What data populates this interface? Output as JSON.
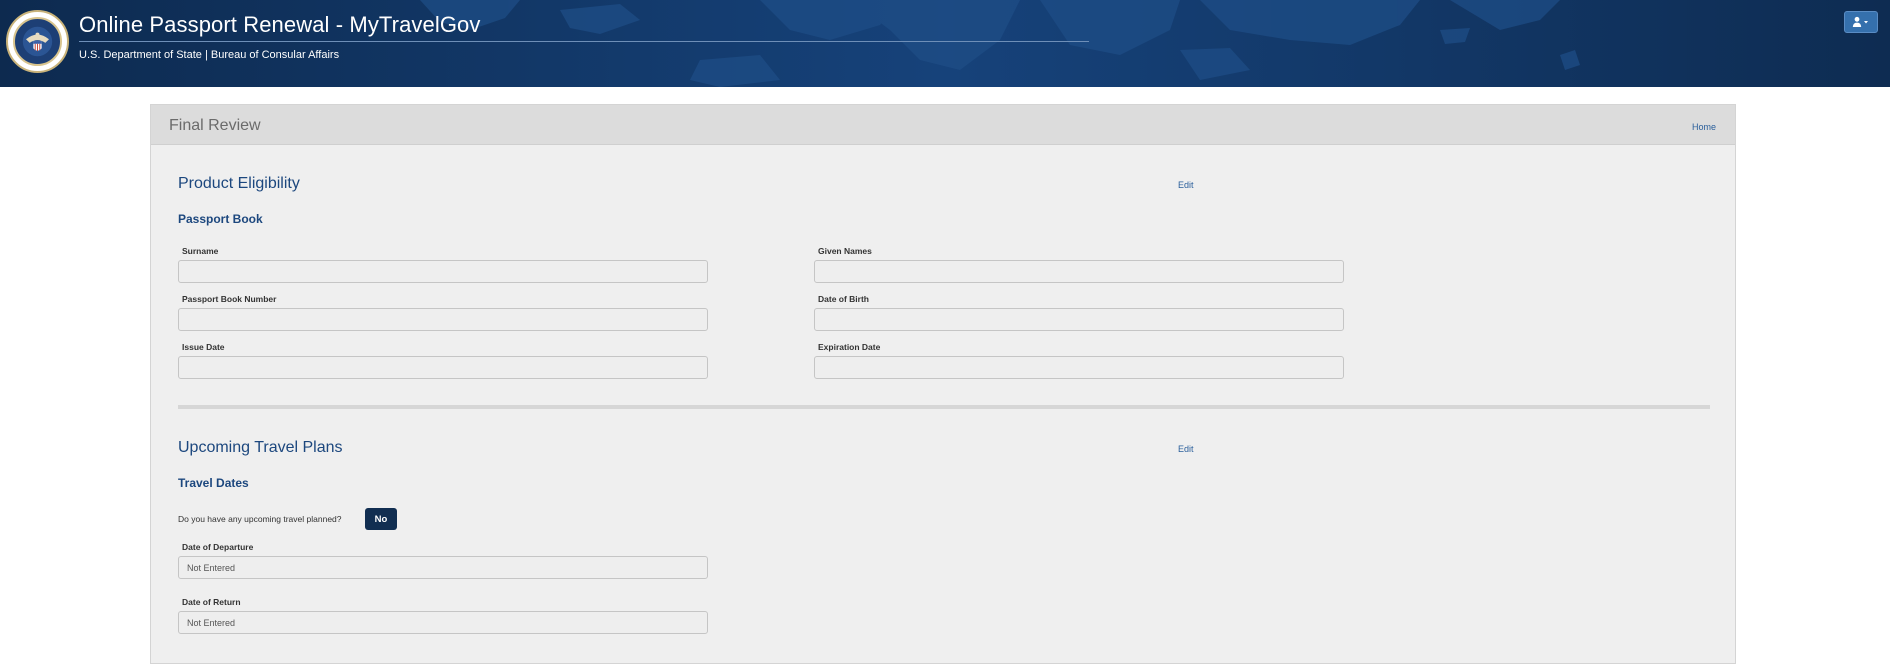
{
  "header": {
    "title": "Online Passport Renewal - MyTravelGov",
    "subtitle": "U.S. Department of State | Bureau of Consular Affairs",
    "seal_icon": "department-of-state-seal",
    "user_menu_icon": "user-caret-icon",
    "background_color": "#0f2f57"
  },
  "panel": {
    "title": "Final Review",
    "home_link": "Home"
  },
  "product_eligibility": {
    "title": "Product Eligibility",
    "edit_label": "Edit",
    "subtitle": "Passport Book",
    "fields": {
      "surname": {
        "label": "Surname",
        "value": ""
      },
      "given_names": {
        "label": "Given Names",
        "value": ""
      },
      "passport_book_number": {
        "label": "Passport Book Number",
        "value": ""
      },
      "date_of_birth": {
        "label": "Date of Birth",
        "value": ""
      },
      "issue_date": {
        "label": "Issue Date",
        "value": ""
      },
      "expiration_date": {
        "label": "Expiration Date",
        "value": ""
      }
    }
  },
  "travel_plans": {
    "title": "Upcoming Travel Plans",
    "edit_label": "Edit",
    "subtitle": "Travel Dates",
    "question": "Do you have any upcoming travel planned?",
    "answer": "No",
    "departure": {
      "label": "Date of Departure",
      "value": "Not Entered"
    },
    "return": {
      "label": "Date of Return",
      "value": "Not Entered"
    }
  },
  "colors": {
    "accent_blue": "#1c477e",
    "link_blue": "#2a5f9b",
    "button_dark": "#112e51"
  }
}
